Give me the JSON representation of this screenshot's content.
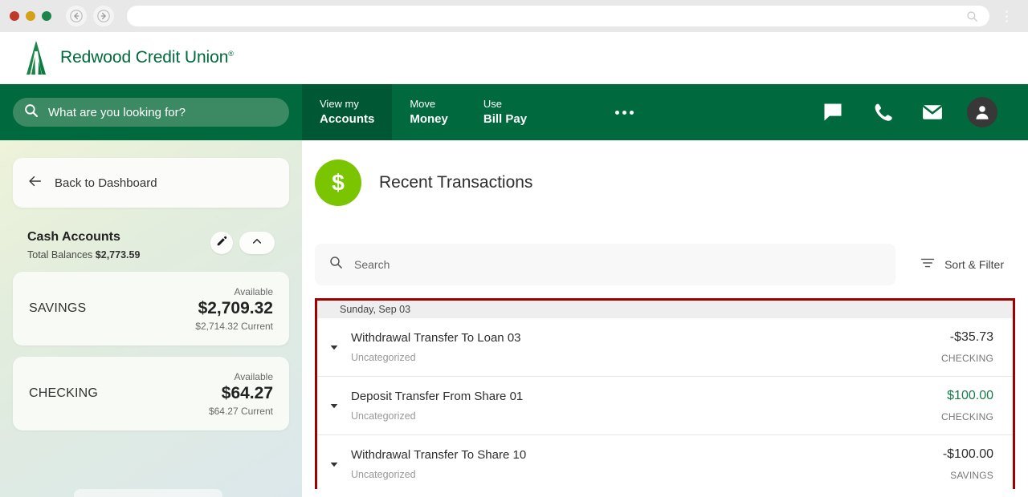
{
  "browser": {
    "url_value": "",
    "url_placeholder": "",
    "back_icon": "back-arrow-icon",
    "forward_icon": "forward-arrow-icon",
    "search_icon": "search-icon",
    "menu_icon": "kebab-menu-icon"
  },
  "site_header": {
    "brand_name": "Redwood Credit Union",
    "trademark": "®",
    "logo_icon": "redwood-tree-logo"
  },
  "nav": {
    "search_placeholder": "What are you looking for?",
    "search_icon": "search-icon",
    "items": [
      {
        "line1": "View my",
        "line2": "Accounts",
        "active": true
      },
      {
        "line1": "Move",
        "line2": "Money",
        "active": false
      },
      {
        "line1": "Use",
        "line2": "Bill Pay",
        "active": false
      }
    ],
    "more_label": "More options",
    "icons": [
      {
        "name": "chat-icon"
      },
      {
        "name": "phone-icon"
      },
      {
        "name": "envelope-icon"
      },
      {
        "name": "user-avatar-icon"
      }
    ],
    "bg_color": "#00693e",
    "active_bg_color": "#005733"
  },
  "sidebar": {
    "back_label": "Back to Dashboard",
    "back_icon": "arrow-left-icon",
    "section_title": "Cash Accounts",
    "total_label": "Total Balances",
    "total_value": "$2,773.59",
    "edit_icon": "pencil-icon",
    "collapse_icon": "chevron-up-icon",
    "accounts": [
      {
        "name": "SAVINGS",
        "available_label": "Available",
        "available_amount": "$2,709.32",
        "current_amount": "$2,714.32 Current"
      },
      {
        "name": "CHECKING",
        "available_label": "Available",
        "available_amount": "$64.27",
        "current_amount": "$64.27 Current"
      }
    ]
  },
  "main": {
    "page_title": "Recent Transactions",
    "title_icon": "dollar-circle-icon",
    "title_icon_color": "#7ac400",
    "search_placeholder": "Search",
    "search_icon": "search-icon",
    "sort_filter_label": "Sort & Filter",
    "sort_filter_icon": "filter-icon",
    "highlight_color": "#9e0000",
    "date_group": "Sunday, Sep 03",
    "transactions": [
      {
        "description": "Withdrawal Transfer To Loan 03",
        "category": "Uncategorized",
        "amount": "-$35.73",
        "account": "CHECKING",
        "positive": false,
        "caret_icon": "caret-down-icon"
      },
      {
        "description": "Deposit Transfer From Share 01",
        "category": "Uncategorized",
        "amount": "$100.00",
        "account": "CHECKING",
        "positive": true,
        "caret_icon": "caret-down-icon"
      },
      {
        "description": "Withdrawal Transfer To Share 10",
        "category": "Uncategorized",
        "amount": "-$100.00",
        "account": "SAVINGS",
        "positive": false,
        "caret_icon": "caret-down-icon"
      }
    ]
  }
}
